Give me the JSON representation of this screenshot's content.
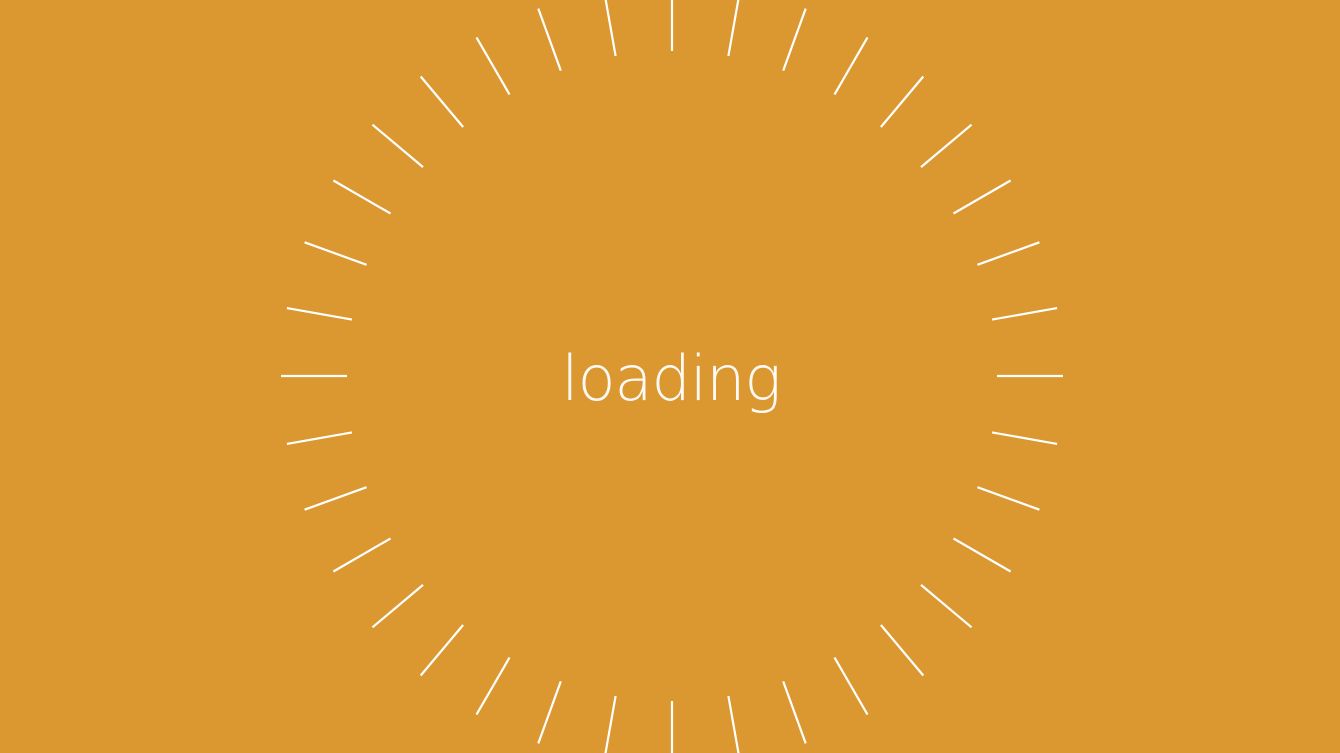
{
  "screen": {
    "background_color": "#DB9730",
    "loading_label": "loading"
  },
  "spinner": {
    "icon": "radial-spinner-icon",
    "tick_count": 36,
    "tick_color": "#FFFFFF"
  }
}
